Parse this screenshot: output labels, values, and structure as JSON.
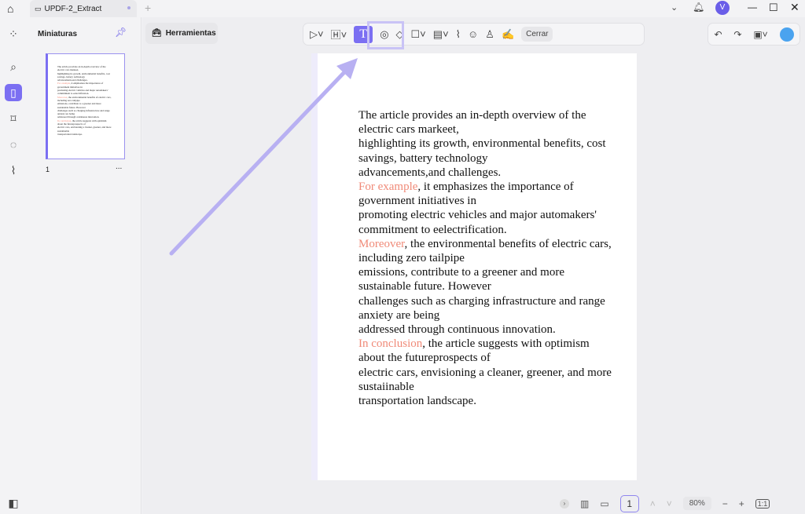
{
  "tab": {
    "title": "UPDF-2_Extract"
  },
  "sidebar": {
    "title": "Miniaturas",
    "page_label": "1",
    "more": "..."
  },
  "toolbar": {
    "tools_label": "Herramientas",
    "close_label": "Cerrar"
  },
  "document": {
    "lines": [
      {
        "red": "",
        "text": "The article provides an in-depth overview of the"
      },
      {
        "red": "",
        "text": "electric cars markeet,"
      },
      {
        "red": "",
        "text": "highlighting its growth, environmental benefits, cost"
      },
      {
        "red": "",
        "text": "savings, battery technology"
      },
      {
        "red": "",
        "text": "advancements,and challenges."
      },
      {
        "red": "For example",
        "text": ", it emphasizes the importance of"
      },
      {
        "red": "",
        "text": "government initiatives in"
      },
      {
        "red": "",
        "text": "promoting electric vehicles and major automakers'"
      },
      {
        "red": "",
        "text": "commitment to eelectrification."
      },
      {
        "red": "Moreover",
        "text": ", the environmental benefits of electric cars,"
      },
      {
        "red": "",
        "text": "including zero tailpipe"
      },
      {
        "red": "",
        "text": "emissions, contribute to a greener and more"
      },
      {
        "red": "",
        "text": "sustainable future. However"
      },
      {
        "red": "",
        "text": "challenges such as charging infrastructure and range"
      },
      {
        "red": "",
        "text": "anxiety are being"
      },
      {
        "red": "",
        "text": "addressed through continuous innovation."
      },
      {
        "red": "In conclusion",
        "text": ", the article suggests with optimism"
      },
      {
        "red": "",
        "text": "about the futureprospects of"
      },
      {
        "red": "",
        "text": "electric cars, envisioning a cleaner, greener, and more"
      },
      {
        "red": "",
        "text": "sustaiinable"
      },
      {
        "red": "",
        "text": "transportation landscape."
      }
    ]
  },
  "bottombar": {
    "page": "1",
    "zoom": "80%"
  },
  "user": {
    "avatar": "V"
  },
  "colors": {
    "accent": "#7b6ff2",
    "highlight": "#f08a78",
    "arrow": "#b8b0f2"
  }
}
